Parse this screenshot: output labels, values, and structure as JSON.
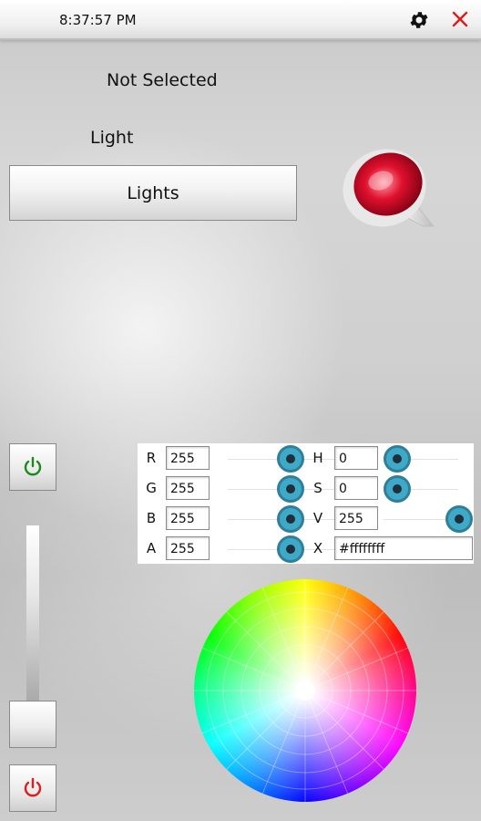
{
  "status": {
    "time": "8:37:57 PM"
  },
  "header": {
    "selection": "Not Selected",
    "group_label": "Light",
    "lights_button": "Lights"
  },
  "colors": {
    "power_on": "#1a8a1a",
    "power_off": "#e01b1b",
    "close": "#e01b1b",
    "knob": "#3fa9c8"
  },
  "picker": {
    "rgba": [
      {
        "label": "R",
        "value": "255"
      },
      {
        "label": "G",
        "value": "255"
      },
      {
        "label": "B",
        "value": "255"
      },
      {
        "label": "A",
        "value": "255"
      }
    ],
    "hsvx": [
      {
        "label": "H",
        "value": "0"
      },
      {
        "label": "S",
        "value": "0"
      },
      {
        "label": "V",
        "value": "255"
      },
      {
        "label": "X",
        "value": "#ffffffff"
      }
    ]
  },
  "icons": [
    "gear-icon",
    "close-icon",
    "lamp-image",
    "power-icon"
  ]
}
